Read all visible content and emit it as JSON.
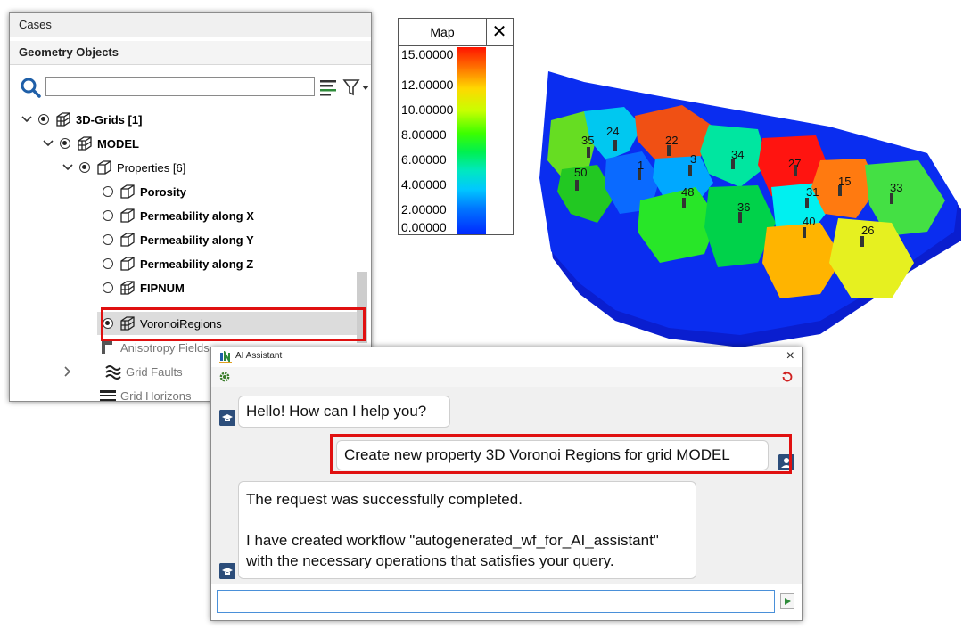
{
  "tree_panel": {
    "cases_label": "Cases",
    "geometry_label": "Geometry Objects",
    "search_value": "",
    "items": [
      {
        "label": "3D-Grids [1]",
        "expanded": true,
        "checked": true
      },
      {
        "label": "MODEL",
        "expanded": true,
        "checked": true
      },
      {
        "label": "Properties [6]",
        "expanded": true,
        "checked": true
      },
      {
        "label": "Porosity",
        "checked": false
      },
      {
        "label": "Permeability along X",
        "checked": false
      },
      {
        "label": "Permeability along Y",
        "checked": false
      },
      {
        "label": "Permeability along Z",
        "checked": false
      },
      {
        "label": "FIPNUM",
        "checked": false
      },
      {
        "label": "VoronoiRegions",
        "checked": true,
        "selected": true
      },
      {
        "label": "Anisotropy Fields"
      },
      {
        "label": "Grid Faults"
      },
      {
        "label": "Grid Horizons"
      }
    ]
  },
  "legend": {
    "title": "Map",
    "close_symbol": "✕",
    "ticks": [
      "15.00000",
      "12.00000",
      "10.00000",
      "8.00000",
      "6.00000",
      "4.00000",
      "2.00000",
      "0.00000"
    ]
  },
  "view3d": {
    "region_labels": [
      "35",
      "24",
      "22",
      "34",
      "27",
      "50",
      "1",
      "3",
      "48",
      "36",
      "31",
      "15",
      "33",
      "40",
      "26"
    ]
  },
  "ai_assistant": {
    "title": "AI Assistant",
    "close_symbol": "×",
    "messages": [
      {
        "from": "assistant",
        "text": "Hello! How can I help you?"
      },
      {
        "from": "user",
        "text": "Create new property 3D Voronoi Regions for grid MODEL"
      },
      {
        "from": "assistant",
        "line1": "The request was successfully completed.",
        "line2": "I have created workflow \"autogenerated_wf_for_AI_assistant\" with the necessary operations that satisfies your query."
      }
    ],
    "input_value": ""
  },
  "colors": {
    "highlight": "#e01010",
    "accent_blue": "#2c4d7a",
    "input_border": "#4a90d9"
  }
}
